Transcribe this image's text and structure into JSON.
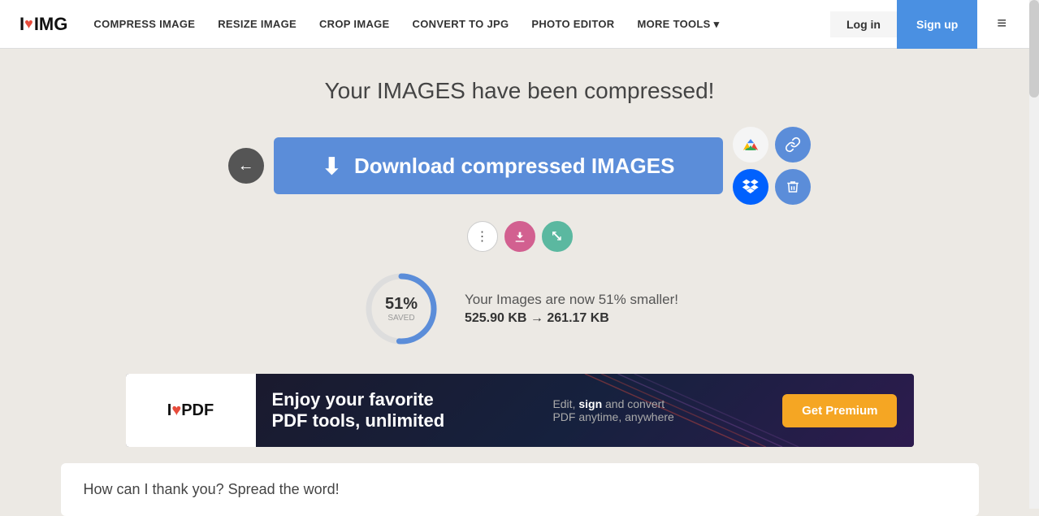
{
  "nav": {
    "logo": {
      "i": "I",
      "heart": "♥",
      "img": "IMG"
    },
    "links": [
      {
        "id": "compress",
        "label": "COMPRESS IMAGE"
      },
      {
        "id": "resize",
        "label": "RESIZE IMAGE"
      },
      {
        "id": "crop",
        "label": "CROP IMAGE"
      },
      {
        "id": "convert",
        "label": "CONVERT TO JPG"
      },
      {
        "id": "photo-editor",
        "label": "PHOTO EDITOR"
      },
      {
        "id": "more-tools",
        "label": "MORE TOOLS"
      }
    ],
    "login_label": "Log in",
    "signup_label": "Sign up",
    "menu_icon": "≡"
  },
  "main": {
    "success_title": "Your IMAGES have been compressed!",
    "download_button_label": "Download compressed IMAGES",
    "download_icon": "⬇",
    "back_icon": "←",
    "progress": {
      "percent": "51%",
      "saved_label": "SAVED",
      "description": "Your Images are now 51% smaller!",
      "size_info": "525.90 KB → 261.17 KB"
    },
    "action_more_icon": "⋮",
    "action_dl_icon": "⬇",
    "action_resize_icon": "⤢",
    "share_drive_icon": "▲",
    "share_link_icon": "🔗",
    "share_dropbox_icon": "◆",
    "share_delete_icon": "🗑"
  },
  "ad": {
    "logo_i": "I",
    "logo_heart": "♥",
    "logo_pdf": "PDF",
    "headline": "Enjoy your favorite\nPDF tools, unlimited",
    "sub_prefix": "Edit, ",
    "sub_sign": "sign",
    "sub_middle": " and convert",
    "sub_line2": "PDF anytime, anywhere",
    "cta_label": "Get Premium"
  },
  "thank": {
    "text": "How can I thank you? Spread the word!"
  }
}
